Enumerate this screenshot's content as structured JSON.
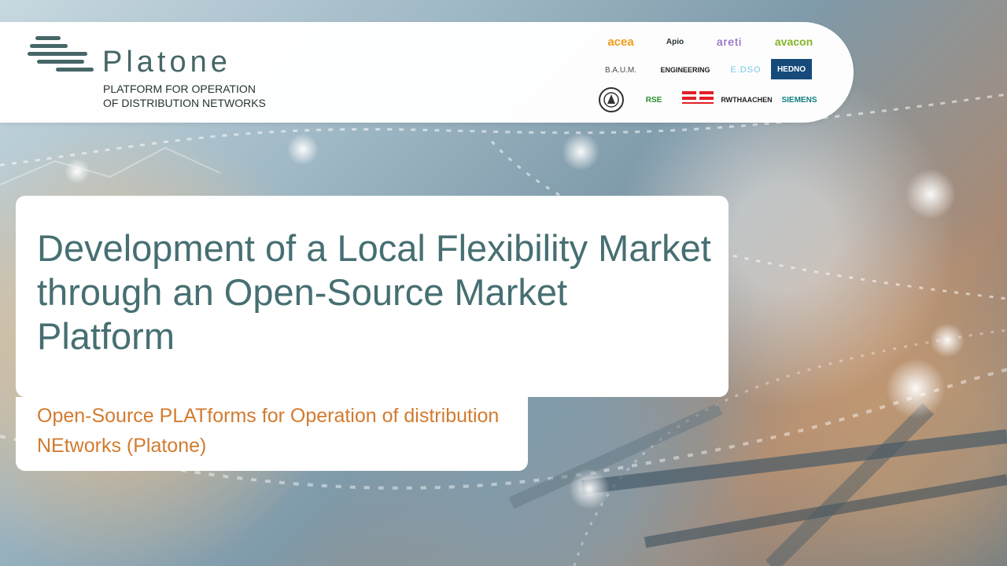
{
  "brand": {
    "name": "Platone",
    "subtitle_line_1": "PLATFORM FOR OPERATION",
    "subtitle_line_2": "OF DISTRIBUTION NETWORKS",
    "accent_color": "#466667"
  },
  "partners": {
    "acea": "acea",
    "apio": "Apio",
    "areti": "areti",
    "avacon": "avacon",
    "baum": "B.A.U.M.",
    "engineering": "ENGINEERING",
    "edso": "E.DSO",
    "hedno": "HEDNO",
    "rse": "RSE",
    "rwth": "RWTHAACHEN",
    "siemens": "SIEMENS"
  },
  "content": {
    "title": "Development of a Local Flexibility Market through an Open-Source Market Platform",
    "subtitle": "Open-Source PLATforms for Operation of distribution NEtworks (Platone)",
    "title_color": "#466f72",
    "subtitle_color": "#d27b2f"
  }
}
